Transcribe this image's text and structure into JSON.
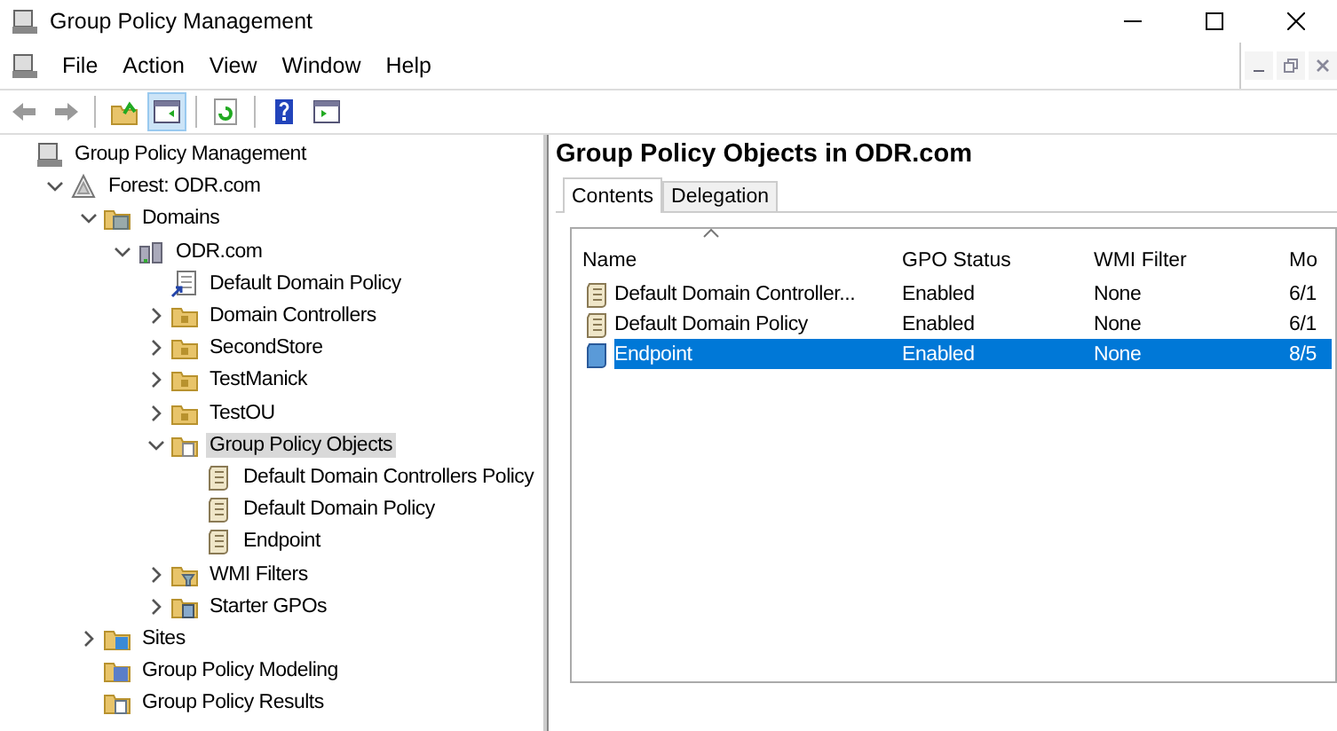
{
  "window": {
    "title": "Group Policy Management"
  },
  "menu": [
    "File",
    "Action",
    "View",
    "Window",
    "Help"
  ],
  "toolbar": [
    {
      "kind": "back",
      "pressed": false
    },
    {
      "kind": "forward",
      "pressed": false
    },
    {
      "kind": "sep"
    },
    {
      "kind": "up",
      "pressed": false
    },
    {
      "kind": "tree",
      "pressed": true
    },
    {
      "kind": "sep"
    },
    {
      "kind": "refresh",
      "pressed": false
    },
    {
      "kind": "sep"
    },
    {
      "kind": "help",
      "pressed": false
    },
    {
      "kind": "pane",
      "pressed": false
    }
  ],
  "tree": [
    {
      "label": "Group Policy Management",
      "kind": "root",
      "selected": false,
      "children": [
        {
          "label": "Forest: ODR.com",
          "kind": "forest",
          "expanded": true,
          "selected": false,
          "children": [
            {
              "label": "Domains",
              "kind": "domains",
              "expanded": true,
              "selected": false,
              "children": [
                {
                  "label": "ODR.com",
                  "kind": "domain",
                  "expanded": true,
                  "selected": false,
                  "children": [
                    {
                      "label": "Default Domain Policy",
                      "kind": "link",
                      "selected": false
                    },
                    {
                      "label": "Domain Controllers",
                      "kind": "ou",
                      "expanded": false,
                      "selected": false
                    },
                    {
                      "label": "SecondStore",
                      "kind": "ou",
                      "expanded": false,
                      "selected": false
                    },
                    {
                      "label": "TestManick",
                      "kind": "ou",
                      "expanded": false,
                      "selected": false
                    },
                    {
                      "label": "TestOU",
                      "kind": "ou",
                      "expanded": false,
                      "selected": false
                    },
                    {
                      "label": "Group Policy Objects",
                      "kind": "gpofolder",
                      "expanded": true,
                      "selected": true,
                      "children": [
                        {
                          "label": "Default Domain Controllers Policy",
                          "kind": "gpo",
                          "selected": false
                        },
                        {
                          "label": "Default Domain Policy",
                          "kind": "gpo",
                          "selected": false
                        },
                        {
                          "label": "Endpoint",
                          "kind": "gpo",
                          "selected": false
                        }
                      ]
                    },
                    {
                      "label": "WMI Filters",
                      "kind": "wmi",
                      "expanded": false,
                      "selected": false
                    },
                    {
                      "label": "Starter GPOs",
                      "kind": "starter",
                      "expanded": false,
                      "selected": false
                    }
                  ]
                }
              ]
            },
            {
              "label": "Sites",
              "kind": "sites",
              "expanded": false,
              "selected": false
            },
            {
              "label": "Group Policy Modeling",
              "kind": "modeling",
              "selected": false
            },
            {
              "label": "Group Policy Results",
              "kind": "results",
              "selected": false
            }
          ]
        }
      ]
    }
  ],
  "content": {
    "title": "Group Policy Objects in ODR.com",
    "tabs": [
      {
        "label": "Contents",
        "selected": true
      },
      {
        "label": "Delegation",
        "selected": false
      }
    ],
    "columns": [
      "Name",
      "GPO Status",
      "WMI Filter",
      "Mo"
    ],
    "rows": [
      {
        "cells": [
          "Default Domain Controller...",
          "Enabled",
          "None",
          "6/1"
        ],
        "selected": false
      },
      {
        "cells": [
          "Default Domain Policy",
          "Enabled",
          "None",
          "6/1"
        ],
        "selected": false
      },
      {
        "cells": [
          "Endpoint",
          "Enabled",
          "None",
          "8/5"
        ],
        "selected": true
      }
    ]
  }
}
